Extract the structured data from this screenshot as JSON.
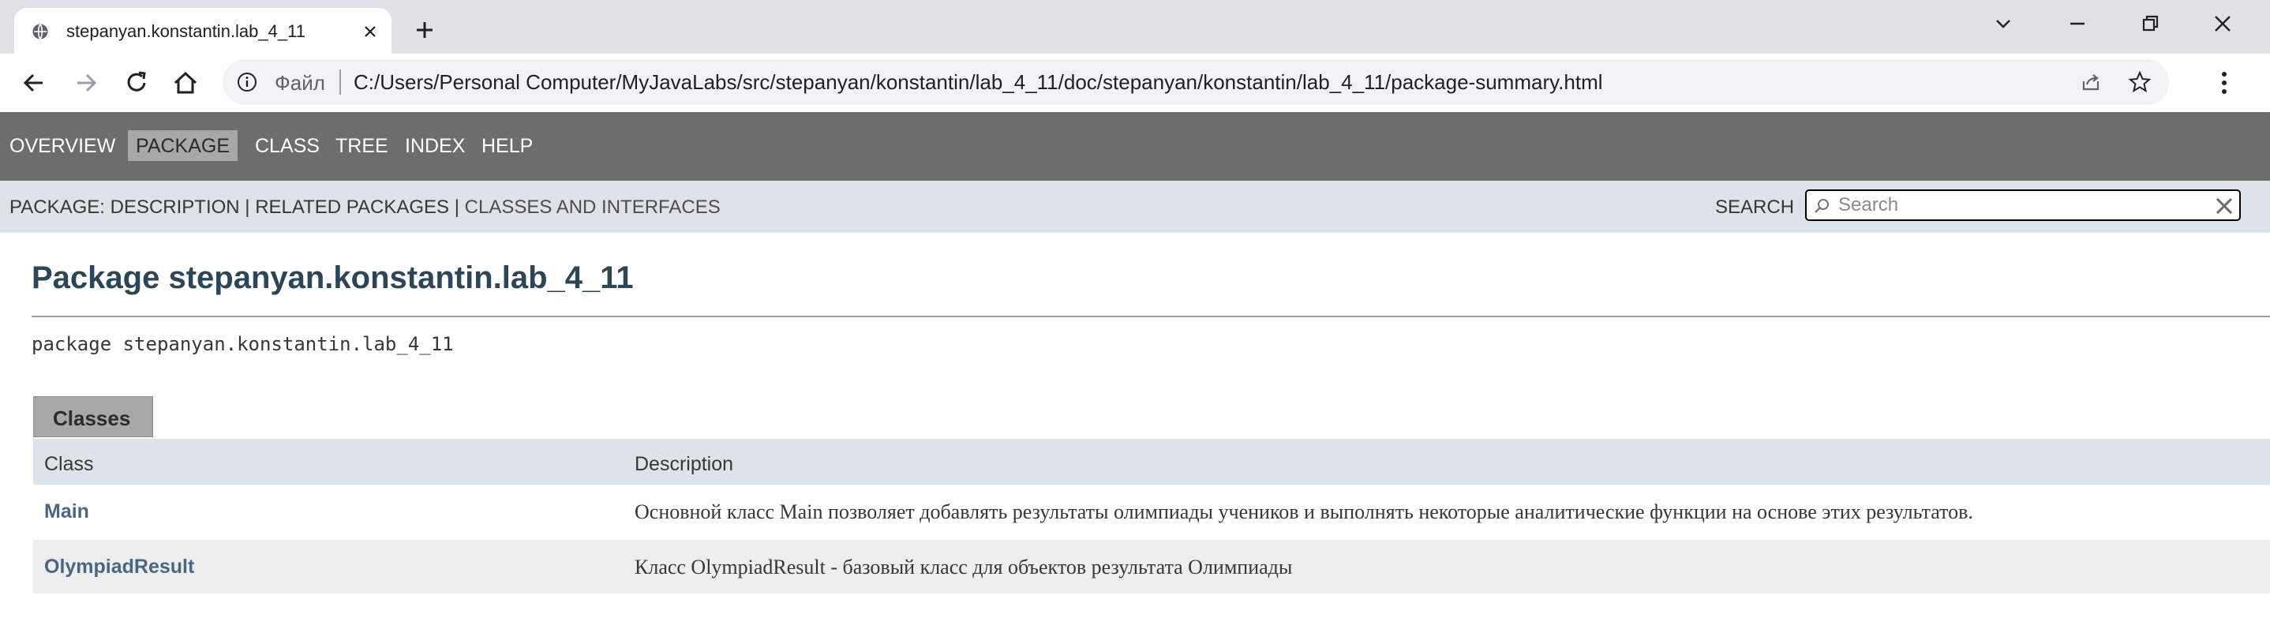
{
  "browser": {
    "tab": {
      "title": "stepanyan.konstantin.lab_4_11"
    },
    "omnibox": {
      "scheme_label": "Файл",
      "url": "C:/Users/Personal Computer/MyJavaLabs/src/stepanyan/konstantin/lab_4_11/doc/stepanyan/konstantin/lab_4_11/package-summary.html"
    }
  },
  "javadoc": {
    "top_nav": [
      "OVERVIEW",
      "PACKAGE",
      "CLASS",
      "TREE",
      "INDEX",
      "HELP"
    ],
    "active_nav": "PACKAGE",
    "subnav": {
      "prefix": "PACKAGE:",
      "description": "DESCRIPTION",
      "sep": "|",
      "related": "RELATED PACKAGES",
      "classes": "CLASSES AND INTERFACES"
    },
    "search": {
      "label": "SEARCH",
      "placeholder": "Search"
    },
    "title": "Package stepanyan.konstantin.lab_4_11",
    "declaration": "package stepanyan.konstantin.lab_4_11",
    "caption": "Classes",
    "table": {
      "headers": {
        "name": "Class",
        "desc": "Description"
      },
      "rows": [
        {
          "name": "Main",
          "desc": "Основной класс Main позволяет добавлять результаты олимпиады учеников и выполнять некоторые аналитические функции на основе этих результатов."
        },
        {
          "name": "OlympiadResult",
          "desc": "Класс OlympiadResult - базовый класс для объектов результата Олимпиады"
        }
      ]
    }
  }
}
